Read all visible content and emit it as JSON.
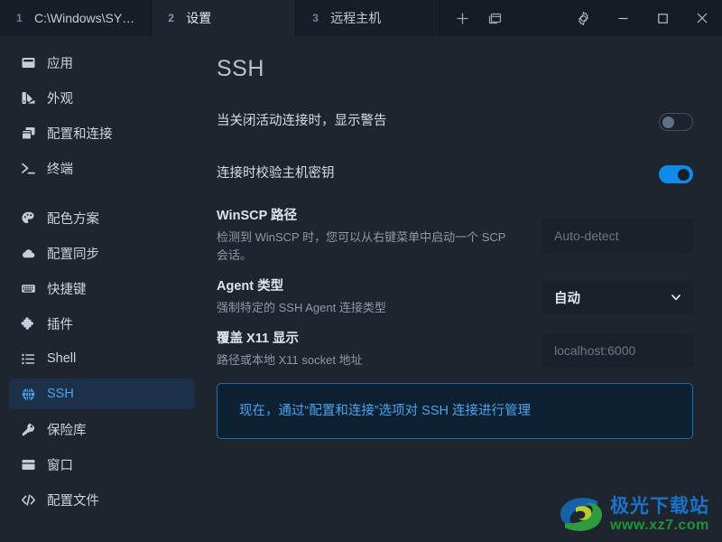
{
  "window": {
    "tabs": [
      {
        "index": "1",
        "title": "C:\\Windows\\SY…",
        "active": false
      },
      {
        "index": "2",
        "title": "设置",
        "active": true
      },
      {
        "index": "3",
        "title": "远程主机",
        "active": false
      }
    ],
    "tab_actions": [
      {
        "name": "new-tab-button",
        "icon": "plus-icon"
      },
      {
        "name": "split-pane-button",
        "icon": "window-split-icon"
      }
    ],
    "controls": [
      {
        "name": "settings-button",
        "icon": "gear-icon"
      },
      {
        "name": "minimize-button",
        "icon": "minimize-icon"
      },
      {
        "name": "maximize-button",
        "icon": "maximize-icon"
      },
      {
        "name": "close-button",
        "icon": "close-icon"
      }
    ]
  },
  "sidebar": {
    "items": [
      {
        "label": "应用",
        "icon": "app-window-icon",
        "selected": false,
        "gap_after": false
      },
      {
        "label": "外观",
        "icon": "palette-swatch-icon",
        "selected": false,
        "gap_after": false
      },
      {
        "label": "配置和连接",
        "icon": "windows-stack-icon",
        "selected": false,
        "gap_after": false
      },
      {
        "label": "终端",
        "icon": "terminal-prompt-icon",
        "selected": false,
        "gap_after": true
      },
      {
        "label": "配色方案",
        "icon": "palette-icon",
        "selected": false,
        "gap_after": false
      },
      {
        "label": "配置同步",
        "icon": "cloud-icon",
        "selected": false,
        "gap_after": false
      },
      {
        "label": "快捷键",
        "icon": "keyboard-icon",
        "selected": false,
        "gap_after": false
      },
      {
        "label": "插件",
        "icon": "puzzle-piece-icon",
        "selected": false,
        "gap_after": false
      },
      {
        "label": "Shell",
        "icon": "list-icon",
        "selected": false,
        "gap_after": false
      },
      {
        "label": "SSH",
        "icon": "globe-icon",
        "selected": true,
        "gap_after": false
      },
      {
        "label": "保险库",
        "icon": "key-icon",
        "selected": false,
        "gap_after": false
      },
      {
        "label": "窗口",
        "icon": "window-icon",
        "selected": false,
        "gap_after": false
      },
      {
        "label": "配置文件",
        "icon": "code-brackets-icon",
        "selected": false,
        "gap_after": false
      }
    ]
  },
  "main": {
    "title": "SSH",
    "settings": [
      {
        "id": "warn-on-close",
        "title": "当关闭活动连接时，显示警告",
        "subtitle": "",
        "control": "toggle",
        "value": "off"
      },
      {
        "id": "verify-host-key",
        "title": "连接时校验主机密钥",
        "subtitle": "",
        "control": "toggle",
        "value": "on"
      },
      {
        "id": "winscp-path",
        "title": "WinSCP 路径",
        "subtitle": "检测到 WinSCP 时，您可以从右键菜单中启动一个 SCP 会话。",
        "control": "input",
        "value": "",
        "placeholder": "Auto-detect"
      },
      {
        "id": "agent-type",
        "title": "Agent 类型",
        "subtitle": "强制特定的 SSH Agent 连接类型",
        "control": "select",
        "value": "自动"
      },
      {
        "id": "x11-display",
        "title": "覆盖 X11 显示",
        "subtitle": "路径或本地 X11 socket 地址",
        "control": "input",
        "value": "",
        "placeholder": "localhost:6000"
      }
    ],
    "banner": "现在，通过“配置和连接”选项对 SSH 连接进行管理"
  },
  "watermark": {
    "name_cn": "极光下载站",
    "url": "www.xz7.com"
  },
  "colors": {
    "background": "#1e252e",
    "tabbar": "#151c24",
    "accent_blue": "#0f8ce8",
    "link_blue": "#4da3ef",
    "selected_nav": "#1c3149",
    "field_bg": "#1a212a",
    "banner_bg": "#0e2132",
    "banner_border": "#1e6fa8",
    "watermark_cn": "#1a73c8",
    "watermark_url": "#1e9438"
  }
}
